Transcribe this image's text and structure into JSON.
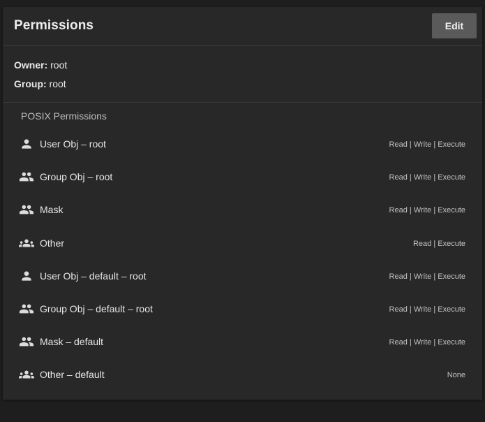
{
  "card": {
    "title": "Permissions",
    "edit_label": "Edit"
  },
  "ownership": {
    "owner_label": "Owner:",
    "owner_value": "root",
    "group_label": "Group:",
    "group_value": "root"
  },
  "posix": {
    "title": "POSIX Permissions",
    "entries": [
      {
        "icon": "person-icon",
        "name": "User Obj – root",
        "perms": "Read | Write | Execute"
      },
      {
        "icon": "people-icon",
        "name": "Group Obj – root",
        "perms": "Read | Write | Execute"
      },
      {
        "icon": "people-icon",
        "name": "Mask",
        "perms": "Read | Write | Execute"
      },
      {
        "icon": "groups-icon",
        "name": "Other",
        "perms": "Read | Execute"
      },
      {
        "icon": "person-icon",
        "name": "User Obj – default – root",
        "perms": "Read | Write | Execute"
      },
      {
        "icon": "people-icon",
        "name": "Group Obj – default – root",
        "perms": "Read | Write | Execute"
      },
      {
        "icon": "people-icon",
        "name": "Mask – default",
        "perms": "Read | Write | Execute"
      },
      {
        "icon": "groups-icon",
        "name": "Other – default",
        "perms": "None"
      }
    ]
  },
  "colors": {
    "page_background": "#1e1e1e",
    "card_background": "#282828",
    "button_background": "#5a5a5a",
    "divider": "#3a3a3a"
  }
}
